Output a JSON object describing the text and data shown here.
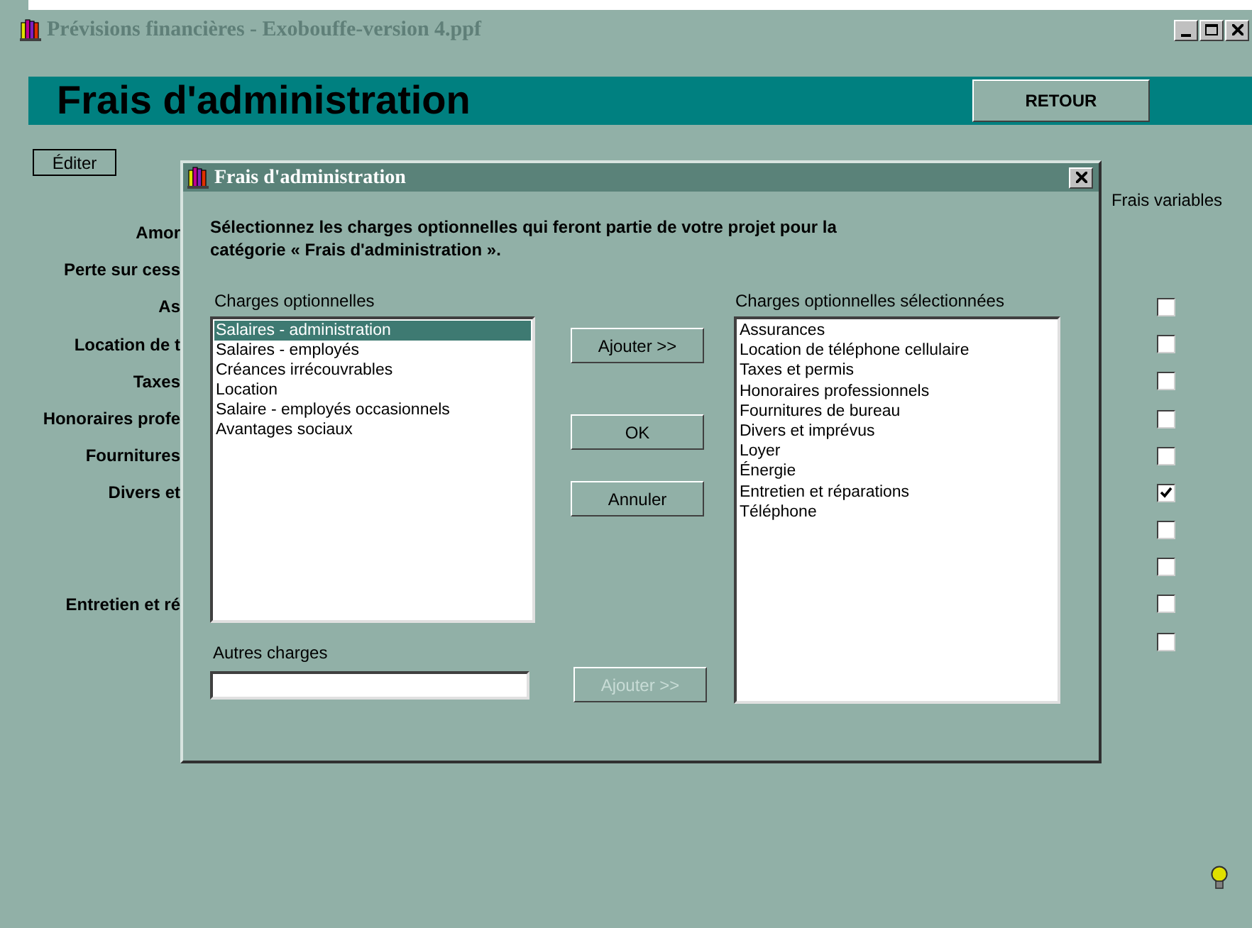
{
  "window": {
    "title": "Prévisions financières - Exobouffe-version 4.ppf"
  },
  "header": {
    "title": "Frais d'administration",
    "back_button": "RETOUR"
  },
  "edit_button": "Éditer",
  "variable_column": "Frais variables",
  "rows": [
    {
      "label": "Amor"
    },
    {
      "label": "Perte sur cess"
    },
    {
      "label": "As",
      "variable": false
    },
    {
      "label": "Location de t",
      "variable": false
    },
    {
      "label": "Taxes",
      "variable": false
    },
    {
      "label": "Honoraires profe",
      "variable": false
    },
    {
      "label": "Fournitures",
      "variable": false
    },
    {
      "label": "Divers et",
      "variable": true
    },
    {
      "variable": false
    },
    {
      "variable": false
    },
    {
      "label": "Entretien et ré",
      "variable": false
    },
    {
      "variable": false
    }
  ],
  "dialog": {
    "title": "Frais d'administration",
    "instruction": "Sélectionnez les charges optionnelles qui feront partie de votre projet pour la catégorie « Frais d'administration ».",
    "optional_label": "Charges optionnelles",
    "optional_items": [
      {
        "label": "Salaires - administration",
        "selected": true
      },
      {
        "label": "Salaires - employés",
        "selected": false
      },
      {
        "label": "Créances irrécouvrables",
        "selected": false
      },
      {
        "label": "Location",
        "selected": false
      },
      {
        "label": "Salaire - employés occasionnels",
        "selected": false
      },
      {
        "label": "Avantages sociaux",
        "selected": false
      }
    ],
    "buttons": [
      {
        "label": "Ajouter >>",
        "disabled": false
      },
      {
        "label": "OK",
        "disabled": false
      },
      {
        "label": "Annuler",
        "disabled": false
      }
    ],
    "other_label": "Autres charges",
    "other_add_button": {
      "label": "Ajouter >>",
      "disabled": true
    },
    "selected_label": "Charges optionnelles sélectionnées",
    "selected_items": [
      "Assurances",
      "Location de téléphone cellulaire",
      "Taxes et permis",
      "Honoraires professionnels",
      "Fournitures de bureau",
      "Divers et imprévus",
      "Loyer",
      "Énergie",
      "Entretien et réparations",
      "Téléphone"
    ]
  }
}
